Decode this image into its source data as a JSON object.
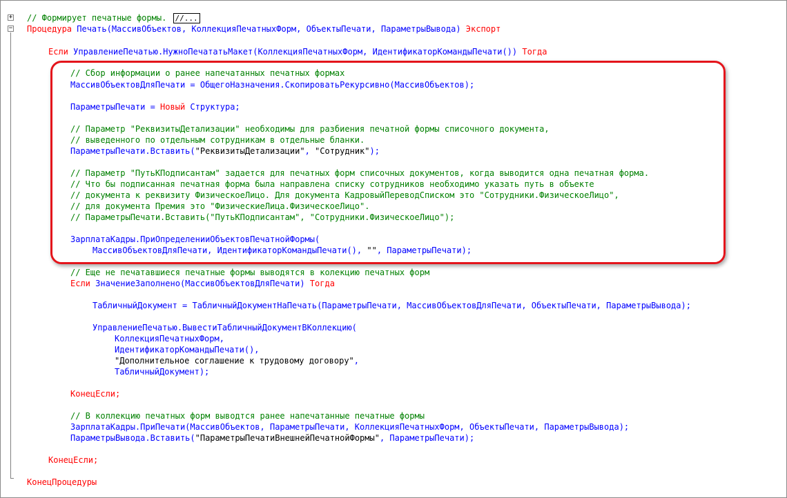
{
  "header_comment": "// Формирует печатные формы.",
  "collapsed_marker": "//...",
  "proc_kw": "Процедура",
  "proc_sig": " Печать(МассивОбъектов, КоллекцияПечатныхФорм, ОбъектыПечати, ПараметрыВывода) ",
  "export_kw": "Экспорт",
  "if1_kw": "Если",
  "if1_expr": " УправлениеПечатью.НужноПечататьМакет(КоллекцияПечатныхФорм, ИдентификаторКомандыПечати()) ",
  "then_kw": "Тогда",
  "c1": "// Сбор информации о ранее напечатанных печатных формах",
  "l_copy": "МассивОбъектовДляПечати = ОбщегоНазначения.СкопироватьРекурсивно(МассивОбъектов);",
  "l_params_a": "ПараметрыПечати = ",
  "new_kw": "Новый",
  "l_params_b": " Структура;",
  "c2": "// Параметр \"РеквизитыДетализации\" необходимы для разбиения печатной формы списочного документа,",
  "c3": "// выведенного по отдельным сотрудникам в отдельные бланки.",
  "l_insert_a": "ПараметрыПечати.Вставить(",
  "str_rekv": "\"РеквизитыДетализации\"",
  "comma_sp": ", ",
  "str_sotr": "\"Сотрудник\"",
  "close_semi": ");",
  "c4": "// Параметр \"ПутьКПодписантам\" задается для печатных форм списочных документов, когда выводится одна печатная форма.",
  "c5": "// Что бы подписанная печатная форма была направлена списку сотрудников необходимо указать путь в объекте",
  "c6": "// документа к реквизиту ФизическоеЛицо. Для документа КадровыйПереводСписком это \"Сотрудники.ФизическоеЛицо\",",
  "c7": "// для документа Премия это \"ФизическиеЛица.ФизическоеЛицо\".",
  "c8": "// ПараметрыПечати.Вставить(\"ПутьКПодписантам\", \"Сотрудники.ФизическоеЛицо\");",
  "l_zk1": "ЗарплатаКадры.ПриОпределенииОбъектовПечатнойФормы(",
  "l_zk2_a": "МассивОбъектовДляПечати, ИдентификаторКомандыПечати(), ",
  "str_empty": "\"\"",
  "l_zk2_b": ", ПараметрыПечати);",
  "c9": "// Еще не печатавшиеся печатные формы выводятся в колекцию печатных форм",
  "if2_expr": " ЗначениеЗаполнено(МассивОбъектовДляПечати) ",
  "l_tab": "ТабличныйДокумент = ТабличныйДокументНаПечать(ПараметрыПечати, МассивОбъектовДляПечати, ОбъектыПечати, ПараметрыВывода);",
  "l_out1": "УправлениеПечатью.ВывестиТабличныйДокументВКоллекцию(",
  "l_out2": "КоллекцияПечатныхФорм,",
  "l_out3": "ИдентификаторКомандыПечати(),",
  "str_doc": "\"Дополнительное соглашение к трудовому договору\"",
  "comma": ",",
  "l_out5": "ТабличныйДокумент);",
  "endif_kw": "КонецЕсли;",
  "c10": "// В коллекцию печатных форм выводтся ранее напечатанные печатные формы",
  "l_zk3": "ЗарплатаКадры.ПриПечати(МассивОбъектов, ПараметрыПечати, КоллекцияПечатныхФорм, ОбъектыПечати, ПараметрыВывода);",
  "l_pv_a": "ПараметрыВывода.Вставить(",
  "str_pv": "\"ПараметрыПечатиВнешнейПечатнойФормы\"",
  "l_pv_b": ", ПараметрыПечати);",
  "endproc_kw": "КонецПроцедуры",
  "colors": {
    "keyword": "#ff0000",
    "identifier": "#0000ff",
    "comment": "#008000",
    "string": "#000000",
    "highlight_border": "#e4141b"
  }
}
